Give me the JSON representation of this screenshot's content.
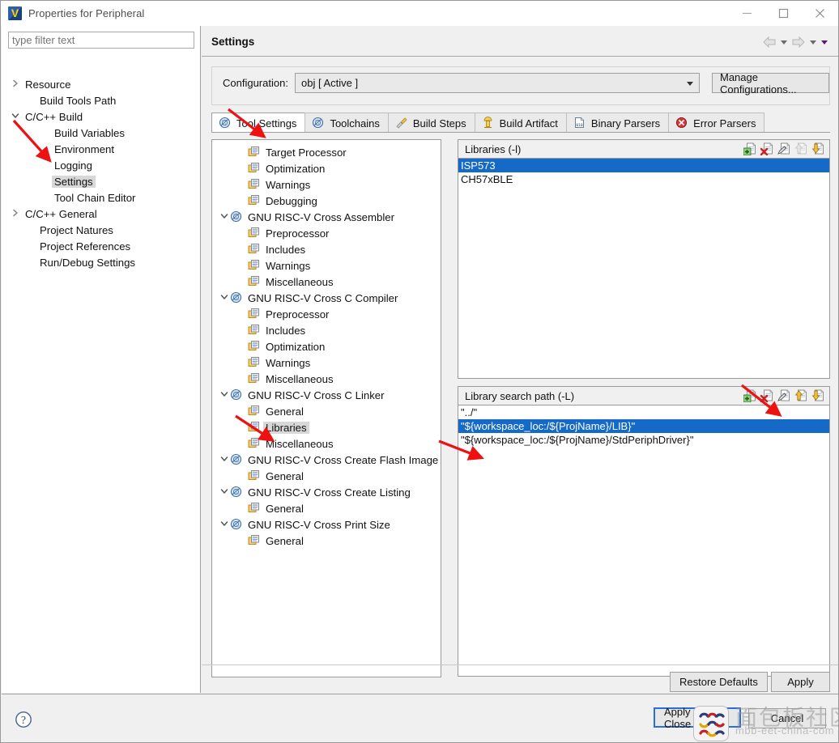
{
  "window": {
    "title": "Properties for Peripheral",
    "app_icon": "eclipse-v-icon",
    "minimize": "minimize-icon",
    "maximize": "maximize-icon",
    "close": "close-icon"
  },
  "sidebar": {
    "filter_placeholder": "type filter text",
    "filter_value": "",
    "items": [
      {
        "label": "Resource",
        "indent": 0,
        "twisty": "collapsed",
        "selected": false
      },
      {
        "label": "Build Tools Path",
        "indent": 1,
        "twisty": "none",
        "selected": false
      },
      {
        "label": "C/C++ Build",
        "indent": 0,
        "twisty": "expanded",
        "selected": false
      },
      {
        "label": "Build Variables",
        "indent": 2,
        "twisty": "none",
        "selected": false
      },
      {
        "label": "Environment",
        "indent": 2,
        "twisty": "none",
        "selected": false
      },
      {
        "label": "Logging",
        "indent": 2,
        "twisty": "none",
        "selected": false
      },
      {
        "label": "Settings",
        "indent": 2,
        "twisty": "none",
        "selected": true
      },
      {
        "label": "Tool Chain Editor",
        "indent": 2,
        "twisty": "none",
        "selected": false
      },
      {
        "label": "C/C++ General",
        "indent": 0,
        "twisty": "collapsed",
        "selected": false
      },
      {
        "label": "Project Natures",
        "indent": 1,
        "twisty": "none",
        "selected": false
      },
      {
        "label": "Project References",
        "indent": 1,
        "twisty": "none",
        "selected": false
      },
      {
        "label": "Run/Debug Settings",
        "indent": 1,
        "twisty": "none",
        "selected": false
      }
    ]
  },
  "page": {
    "title": "Settings",
    "nav": {
      "back": "back-arrow-icon",
      "back_menu": "chevron-down-icon",
      "forward": "forward-arrow-icon",
      "forward_menu": "chevron-down-icon",
      "view_menu": "view-menu-icon"
    }
  },
  "configuration": {
    "label": "Configuration:",
    "value": "obj  [ Active ]",
    "manage_button": "Manage Configurations..."
  },
  "tabs": [
    {
      "label": "Tool Settings",
      "icon": "tool-settings-icon",
      "active": true
    },
    {
      "label": "Toolchains",
      "icon": "toolchains-icon",
      "active": false
    },
    {
      "label": "Build Steps",
      "icon": "build-steps-icon",
      "active": false
    },
    {
      "label": "Build Artifact",
      "icon": "build-artifact-icon",
      "active": false
    },
    {
      "label": "Binary Parsers",
      "icon": "binary-parsers-icon",
      "active": false
    },
    {
      "label": "Error Parsers",
      "icon": "error-parsers-icon",
      "active": false
    }
  ],
  "tool_tree": [
    {
      "label": "Target Processor",
      "indent": 1,
      "twisty": "none",
      "icon": "folder-page-icon",
      "selected": false
    },
    {
      "label": "Optimization",
      "indent": 1,
      "twisty": "none",
      "icon": "folder-page-icon",
      "selected": false
    },
    {
      "label": "Warnings",
      "indent": 1,
      "twisty": "none",
      "icon": "folder-page-icon",
      "selected": false
    },
    {
      "label": "Debugging",
      "indent": 1,
      "twisty": "none",
      "icon": "folder-page-icon",
      "selected": false
    },
    {
      "label": "GNU RISC-V Cross Assembler",
      "indent": 0,
      "twisty": "expanded",
      "icon": "tool-gear-icon",
      "selected": false
    },
    {
      "label": "Preprocessor",
      "indent": 1,
      "twisty": "none",
      "icon": "folder-page-icon",
      "selected": false
    },
    {
      "label": "Includes",
      "indent": 1,
      "twisty": "none",
      "icon": "folder-page-icon",
      "selected": false
    },
    {
      "label": "Warnings",
      "indent": 1,
      "twisty": "none",
      "icon": "folder-page-icon",
      "selected": false
    },
    {
      "label": "Miscellaneous",
      "indent": 1,
      "twisty": "none",
      "icon": "folder-page-icon",
      "selected": false
    },
    {
      "label": "GNU RISC-V Cross C Compiler",
      "indent": 0,
      "twisty": "expanded",
      "icon": "tool-gear-icon",
      "selected": false
    },
    {
      "label": "Preprocessor",
      "indent": 1,
      "twisty": "none",
      "icon": "folder-page-icon",
      "selected": false
    },
    {
      "label": "Includes",
      "indent": 1,
      "twisty": "none",
      "icon": "folder-page-icon",
      "selected": false
    },
    {
      "label": "Optimization",
      "indent": 1,
      "twisty": "none",
      "icon": "folder-page-icon",
      "selected": false
    },
    {
      "label": "Warnings",
      "indent": 1,
      "twisty": "none",
      "icon": "folder-page-icon",
      "selected": false
    },
    {
      "label": "Miscellaneous",
      "indent": 1,
      "twisty": "none",
      "icon": "folder-page-icon",
      "selected": false
    },
    {
      "label": "GNU RISC-V Cross C Linker",
      "indent": 0,
      "twisty": "expanded",
      "icon": "tool-gear-icon",
      "selected": false
    },
    {
      "label": "General",
      "indent": 1,
      "twisty": "none",
      "icon": "folder-page-icon",
      "selected": false
    },
    {
      "label": "Libraries",
      "indent": 1,
      "twisty": "none",
      "icon": "folder-page-icon",
      "selected": true
    },
    {
      "label": "Miscellaneous",
      "indent": 1,
      "twisty": "none",
      "icon": "folder-page-icon",
      "selected": false
    },
    {
      "label": "GNU RISC-V Cross Create Flash Image",
      "indent": 0,
      "twisty": "expanded",
      "icon": "tool-gear-icon",
      "selected": false
    },
    {
      "label": "General",
      "indent": 1,
      "twisty": "none",
      "icon": "folder-page-icon",
      "selected": false
    },
    {
      "label": "GNU RISC-V Cross Create Listing",
      "indent": 0,
      "twisty": "expanded",
      "icon": "tool-gear-icon",
      "selected": false
    },
    {
      "label": "General",
      "indent": 1,
      "twisty": "none",
      "icon": "folder-page-icon",
      "selected": false
    },
    {
      "label": "GNU RISC-V Cross Print Size",
      "indent": 0,
      "twisty": "expanded",
      "icon": "tool-gear-icon",
      "selected": false
    },
    {
      "label": "General",
      "indent": 1,
      "twisty": "none",
      "icon": "folder-page-icon",
      "selected": false
    }
  ],
  "libraries_panel": {
    "title": "Libraries (-l)",
    "toolbar": [
      {
        "name": "add-icon",
        "enabled": true
      },
      {
        "name": "delete-icon",
        "enabled": true
      },
      {
        "name": "edit-icon",
        "enabled": true
      },
      {
        "name": "move-up-icon",
        "enabled": false
      },
      {
        "name": "move-down-icon",
        "enabled": true
      }
    ],
    "items": [
      {
        "value": "ISP573",
        "selected": true
      },
      {
        "value": "CH57xBLE",
        "selected": false
      }
    ]
  },
  "library_search_path_panel": {
    "title": "Library search path (-L)",
    "toolbar": [
      {
        "name": "add-icon",
        "enabled": true
      },
      {
        "name": "delete-icon",
        "enabled": true
      },
      {
        "name": "edit-icon",
        "enabled": true
      },
      {
        "name": "move-up-icon",
        "enabled": true
      },
      {
        "name": "move-down-icon",
        "enabled": true
      }
    ],
    "items": [
      {
        "value": "\"../\"",
        "selected": false
      },
      {
        "value": "\"${workspace_loc:/${ProjName}/LIB}\"",
        "selected": true
      },
      {
        "value": "\"${workspace_loc:/${ProjName}/StdPeriphDriver}\"",
        "selected": false
      }
    ]
  },
  "buttons": {
    "restore_defaults": "Restore Defaults",
    "apply": "Apply",
    "apply_and_close": "Apply and Close",
    "cancel": "Cancel"
  },
  "status": {
    "help": "help-icon"
  },
  "watermark": {
    "cn": "面包板社区",
    "en": "mbb-eet-china-com"
  },
  "colors": {
    "selection_blue": "#1569c7",
    "annotation_red": "#ee1111",
    "tree_selected_gray": "#d8d8d8",
    "focus_blue": "#2a6ed6"
  }
}
